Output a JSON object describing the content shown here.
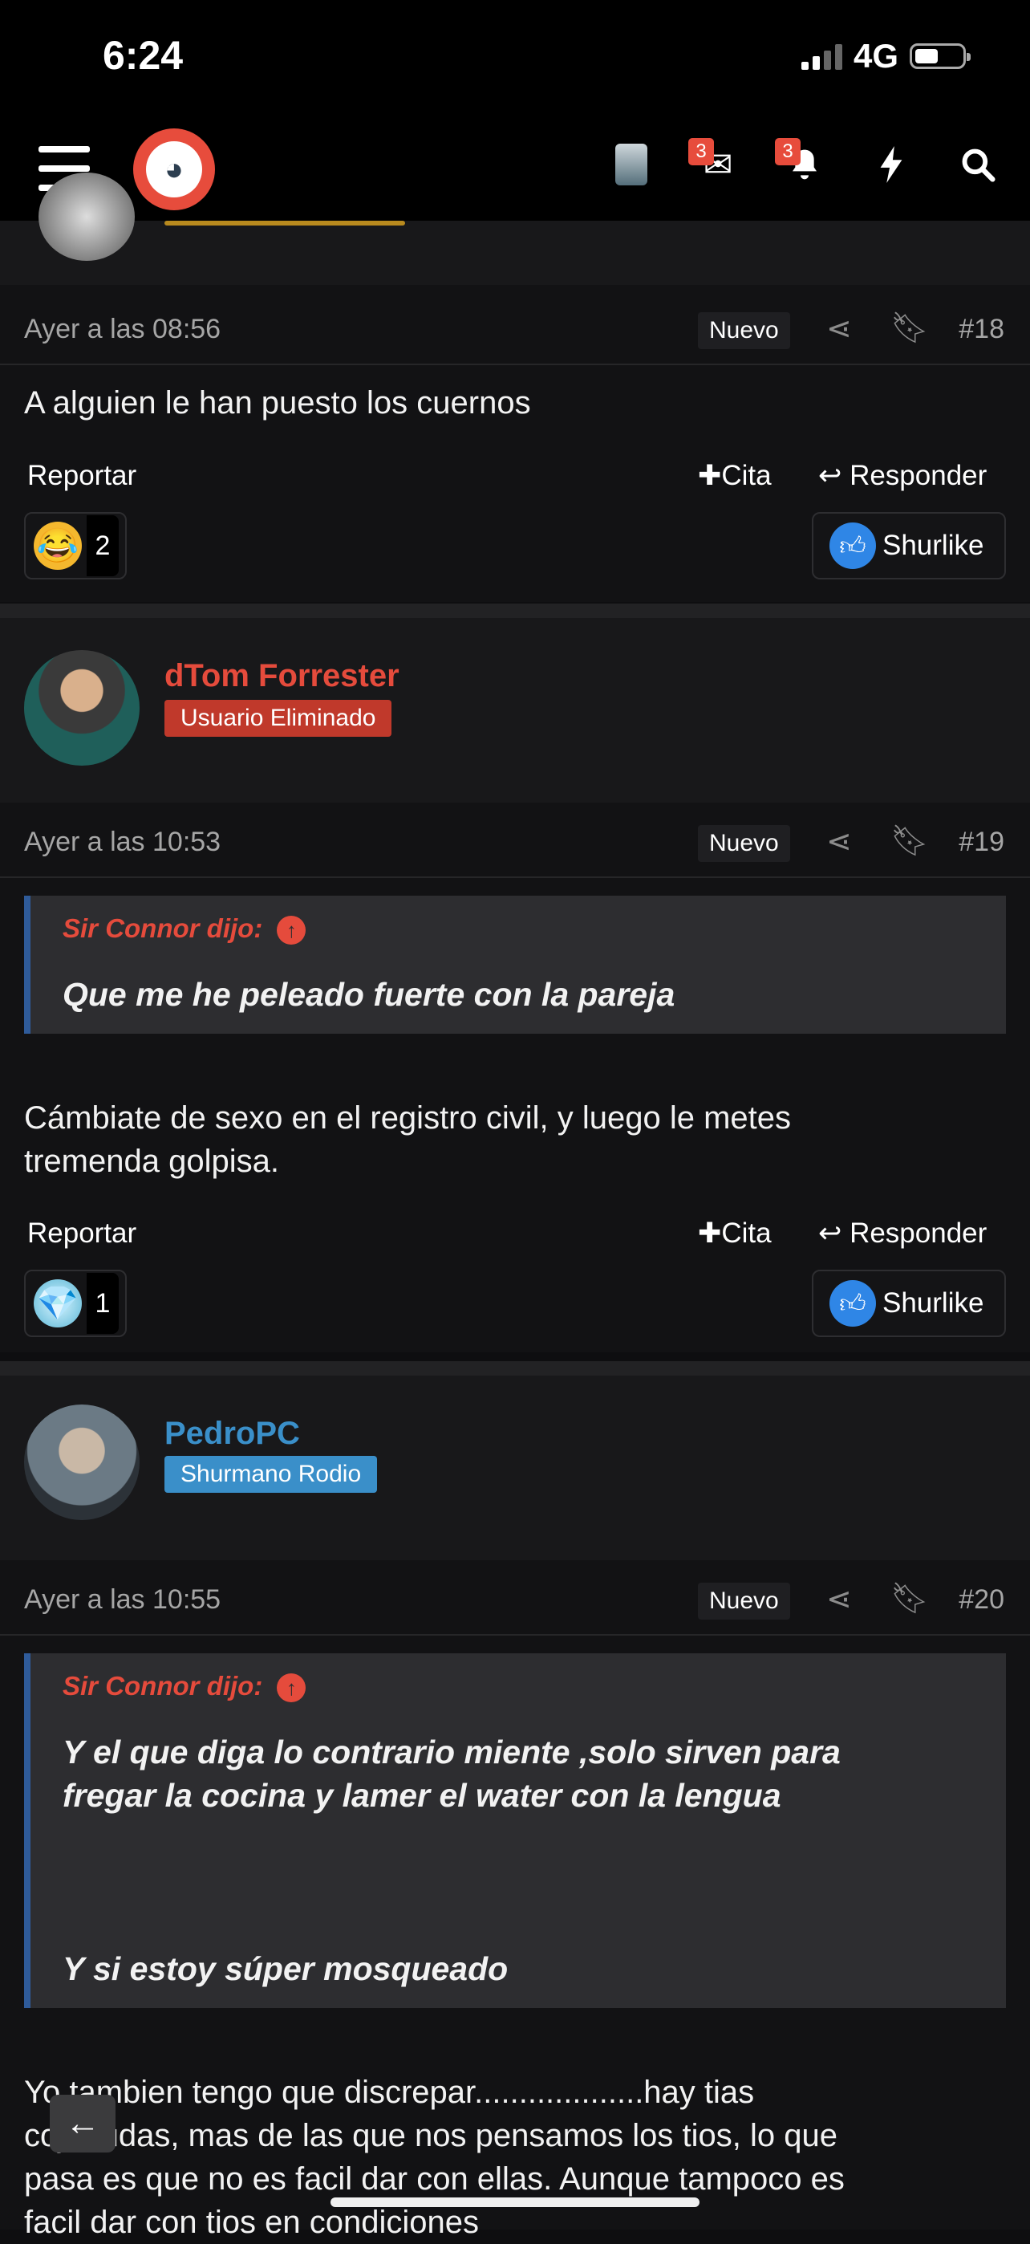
{
  "status_bar": {
    "time": "6:24",
    "network": "4G"
  },
  "nav": {
    "messages_count": "3",
    "alerts_count": "3"
  },
  "top_remnant": {},
  "posts": [
    {
      "date": "Ayer a las 08:56",
      "new_label": "Nuevo",
      "number": "#18",
      "text": "A alguien le han puesto los cuernos",
      "report": "Reportar",
      "quote_btn": "Cita",
      "reply_btn": "Responder",
      "reaction_count": "2",
      "like_label": "Shurlike"
    },
    {
      "username": "dTom Forrester",
      "badge": "Usuario Eliminado",
      "date": "Ayer a las 10:53",
      "new_label": "Nuevo",
      "number": "#19",
      "quote_author": "Sir Connor dijo:",
      "quote_lines": [
        "Que me he peleado fuerte con la pareja"
      ],
      "text_lines": [
        "Cámbiate de sexo en el registro civil, y luego le metes",
        "tremenda golpisa."
      ],
      "report": "Reportar",
      "quote_btn": "Cita",
      "reply_btn": "Responder",
      "reaction_count": "1",
      "like_label": "Shurlike"
    },
    {
      "username": "PedroPC",
      "badge": "Shurmano Rodio",
      "date": "Ayer a las 10:55",
      "new_label": "Nuevo",
      "number": "#20",
      "quote_author": "Sir Connor dijo:",
      "quote_lines": [
        "Y el que diga lo contrario miente ,solo sirven para",
        "fregar la cocina y lamer el water con la lengua",
        "Y si estoy súper mosqueado"
      ],
      "text_lines": [
        "Yo tambien tengo que discrepar...................hay tias",
        "cojonudas, mas de las que nos pensamos los tios, lo que",
        "pasa es que no es facil dar con ellas. Aunque tampoco es",
        "facil dar con tios en condiciones"
      ]
    }
  ],
  "colors": {
    "accent_red": "#e54b3c",
    "badge_red": "#c0392b",
    "badge_blue": "#3a8fc9",
    "username_blue": "#3a8fc9",
    "like_blue": "#2f86e6"
  }
}
